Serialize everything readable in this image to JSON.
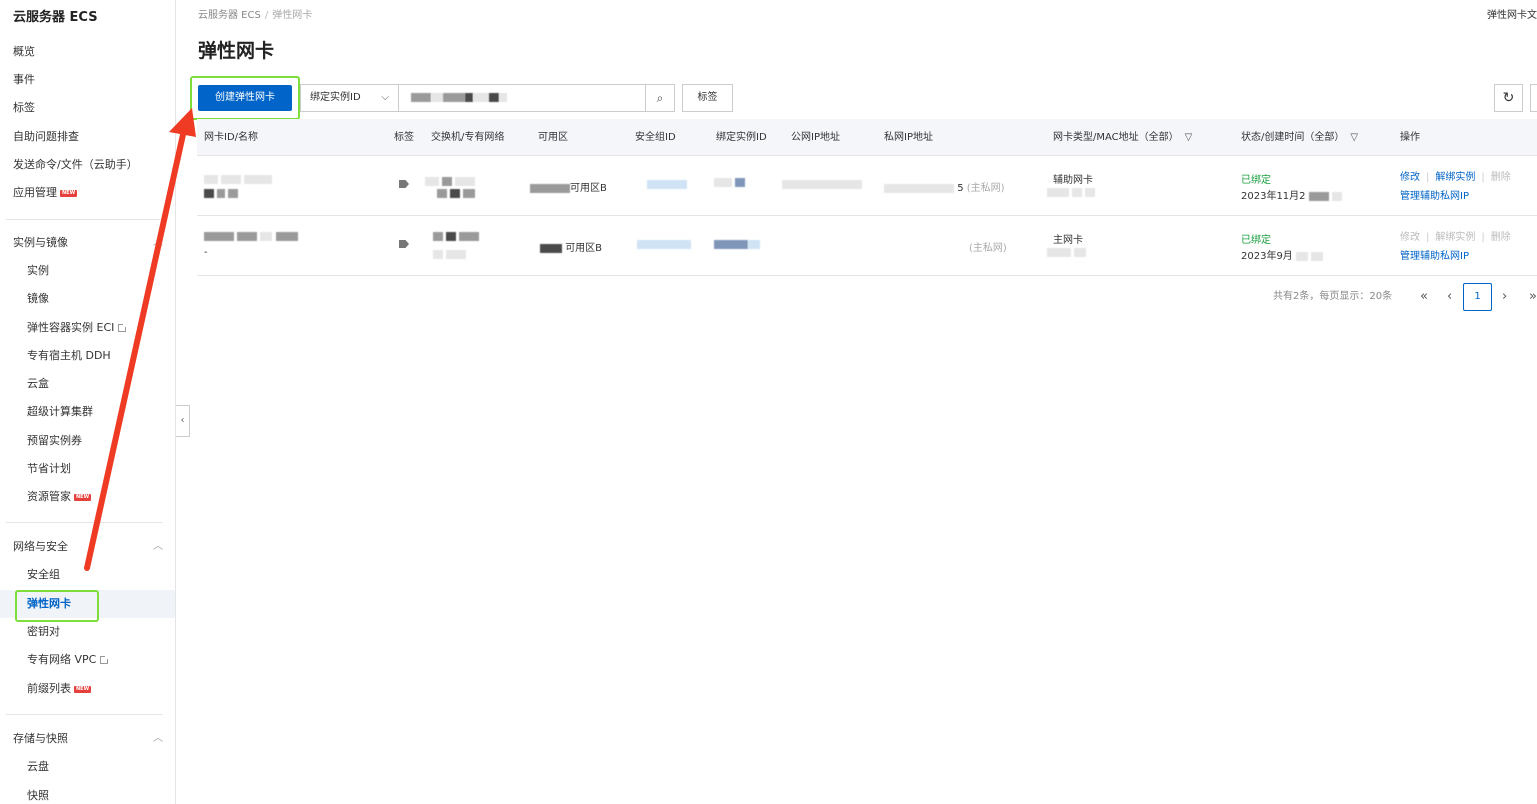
{
  "sidebar": {
    "title": "云服务器 ECS",
    "top_items": [
      "概览",
      "事件",
      "标签",
      "自助问题排查",
      "发送命令/文件（云助手）",
      "应用管理"
    ],
    "new_badge": "NEW",
    "groups": [
      {
        "label": "实例与镜像",
        "items": [
          "实例",
          "镜像",
          "弹性容器实例 ECI",
          "专有宿主机 DDH",
          "云盒",
          "超级计算集群",
          "预留实例券",
          "节省计划",
          "资源管家"
        ]
      },
      {
        "label": "网络与安全",
        "items": [
          "安全组",
          "弹性网卡",
          "密钥对",
          "专有网络 VPC",
          "前缀列表"
        ]
      },
      {
        "label": "存储与快照",
        "items": [
          "云盘",
          "快照"
        ]
      }
    ]
  },
  "breadcrumb": {
    "root": "云服务器 ECS",
    "sep": "/",
    "current": "弹性网卡"
  },
  "top_right_text": "弹性网卡文",
  "page_title": "弹性网卡",
  "toolbar": {
    "create_button": "创建弹性网卡",
    "search_field_select": "绑定实例ID",
    "tag_button": "标签"
  },
  "table": {
    "headers": [
      "网卡ID/名称",
      "标签",
      "交换机/专有网络",
      "可用区",
      "安全组ID",
      "绑定实例ID",
      "公网IP地址",
      "私网IP地址",
      "网卡类型/MAC地址（全部）",
      "状态/创建时间（全部）",
      "操作"
    ],
    "rows": [
      {
        "zone": "可用区B",
        "private_ip_suffix": "(主私网)",
        "private_ip_prefix": "5",
        "eni_type": "辅助网卡",
        "status": "已绑定",
        "created": "2023年11月2",
        "actions": {
          "modify": "修改",
          "detach": "解绑实例",
          "delete": "删除",
          "manage_ip": "管理辅助私网IP"
        }
      },
      {
        "zone": "可用区B",
        "private_ip_suffix": "(主私网)",
        "eni_type": "主网卡",
        "status": "已绑定",
        "created": "2023年9月",
        "actions": {
          "modify": "修改",
          "detach": "解绑实例",
          "delete": "删除",
          "manage_ip": "管理辅助私网IP"
        }
      }
    ]
  },
  "pagination": {
    "info": "共有2条，每页显示：20条",
    "first": "«",
    "prev": "‹",
    "current": "1",
    "next": "›",
    "last": "»"
  },
  "colors": {
    "primary": "#0064c8",
    "highlight": "#7ddd3b",
    "arrow": "#ef3b24",
    "success": "#1b9e3e"
  }
}
